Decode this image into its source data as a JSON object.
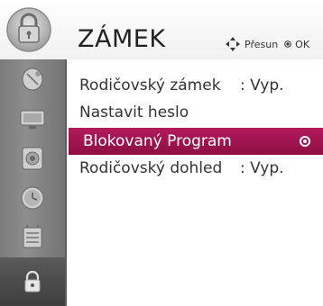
{
  "header": {
    "title": "ZÁMEK",
    "hint_move": "Přesun",
    "hint_ok": "OK",
    "icon": "lock-icon"
  },
  "sidebar": {
    "items": [
      {
        "icon": "satellite-dish-icon"
      },
      {
        "icon": "tv-picture-icon"
      },
      {
        "icon": "speaker-icon"
      },
      {
        "icon": "clock-icon"
      },
      {
        "icon": "option-settings-icon"
      },
      {
        "icon": "lock-icon",
        "active": true
      }
    ]
  },
  "menu": {
    "items": [
      {
        "label": "Rodičovský zámek",
        "value": ": Vyp."
      },
      {
        "label": "Nastavit heslo",
        "value": ""
      },
      {
        "label": "Blokovaný Program",
        "value": ""
      },
      {
        "label": "Rodičovský dohled",
        "value": ": Vyp."
      }
    ],
    "selected_index": 2
  },
  "colors": {
    "highlight": "#a3164f",
    "sidebar": "#858585",
    "text": "#333333"
  }
}
